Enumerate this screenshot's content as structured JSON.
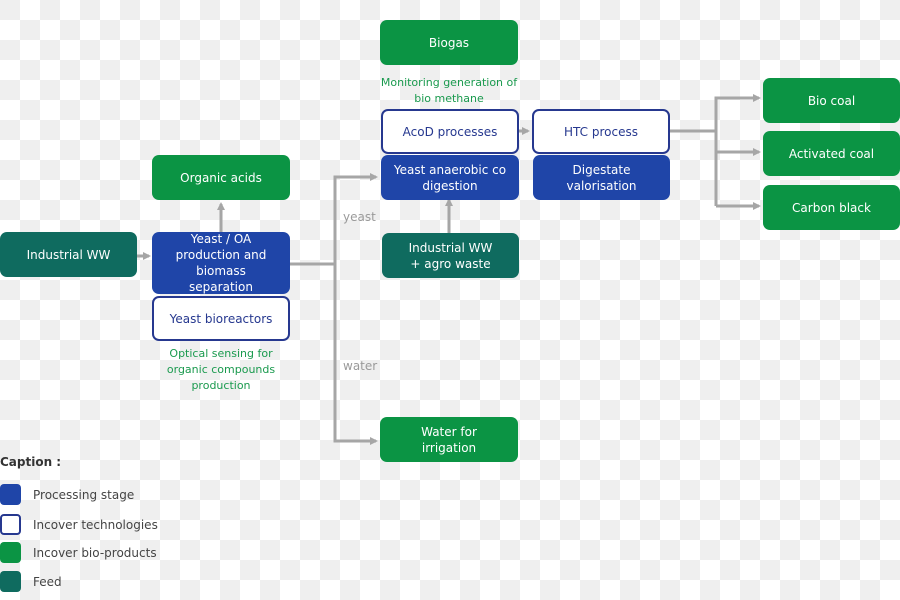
{
  "nodes": {
    "industrial_ww": "Industrial WW",
    "yeast_oa": "Yeast / OA production and biomass separation",
    "organic_acids": "Organic acids",
    "yeast_bioreactors": "Yeast bioreactors",
    "biogas": "Biogas",
    "acod_processes": "AcoD processes",
    "yeast_anaerobic": "Yeast anaerobic co digestion",
    "htc_process": "HTC process",
    "digestate": "Digestate valorisation",
    "industrial_ww_agro": "Industrial WW + agro waste",
    "water_irrigation": "Water for irrigation",
    "bio_coal": "Bio coal",
    "activated_coal": "Activated coal",
    "carbon_black": "Carbon black"
  },
  "notes": {
    "optical_sensing": "Optical sensing for organic compounds production",
    "monitoring_methane": "Monitoring generation of bio methane"
  },
  "flow_labels": {
    "yeast": "yeast",
    "water": "water"
  },
  "legend": {
    "title": "Caption :",
    "items": [
      {
        "label": "Processing stage",
        "color": "#1f45a8"
      },
      {
        "label": "Incover technologies",
        "color": "#ffffff"
      },
      {
        "label": "Incover bio-products",
        "color": "#0b9444"
      },
      {
        "label": "Feed",
        "color": "#0f6b5f"
      }
    ]
  },
  "colors": {
    "processing": "#1f45a8",
    "technology_border": "#26388f",
    "product": "#0b9444",
    "feed": "#0f6b5f",
    "arrow": "#a6a6a6",
    "note_text": "#1a9a4e"
  }
}
